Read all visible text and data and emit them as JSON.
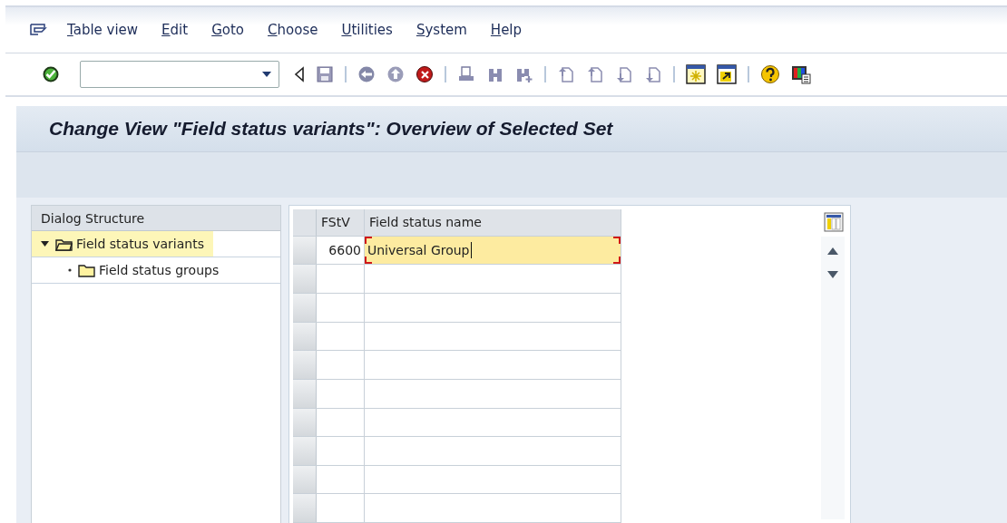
{
  "menu": [
    {
      "label": "Table view"
    },
    {
      "label": "Edit"
    },
    {
      "label": "Goto"
    },
    {
      "label": "Choose"
    },
    {
      "label": "Utilities"
    },
    {
      "label": "System"
    },
    {
      "label": "Help"
    }
  ],
  "title": "Change View \"Field status variants\": Overview of Selected Set",
  "dialog_structure": {
    "header": "Dialog Structure",
    "items": [
      {
        "label": "Field status variants",
        "selected": true,
        "expanded": true,
        "children": [
          {
            "label": "Field status groups",
            "selected": false
          }
        ]
      }
    ]
  },
  "table": {
    "columns": [
      "FStV",
      "Field status name"
    ],
    "rows": [
      {
        "fstv": "6600",
        "name": "Universal Group",
        "focused": true
      }
    ]
  }
}
